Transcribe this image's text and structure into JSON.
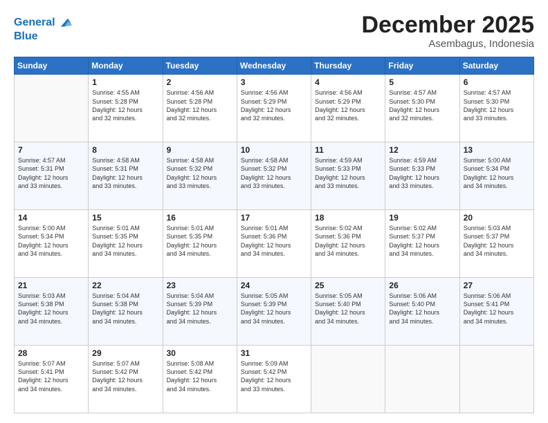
{
  "header": {
    "logo_line1": "General",
    "logo_line2": "Blue",
    "month": "December 2025",
    "location": "Asembagus, Indonesia"
  },
  "weekdays": [
    "Sunday",
    "Monday",
    "Tuesday",
    "Wednesday",
    "Thursday",
    "Friday",
    "Saturday"
  ],
  "weeks": [
    [
      {
        "day": "",
        "info": ""
      },
      {
        "day": "1",
        "info": "Sunrise: 4:55 AM\nSunset: 5:28 PM\nDaylight: 12 hours\nand 32 minutes."
      },
      {
        "day": "2",
        "info": "Sunrise: 4:56 AM\nSunset: 5:28 PM\nDaylight: 12 hours\nand 32 minutes."
      },
      {
        "day": "3",
        "info": "Sunrise: 4:56 AM\nSunset: 5:29 PM\nDaylight: 12 hours\nand 32 minutes."
      },
      {
        "day": "4",
        "info": "Sunrise: 4:56 AM\nSunset: 5:29 PM\nDaylight: 12 hours\nand 32 minutes."
      },
      {
        "day": "5",
        "info": "Sunrise: 4:57 AM\nSunset: 5:30 PM\nDaylight: 12 hours\nand 32 minutes."
      },
      {
        "day": "6",
        "info": "Sunrise: 4:57 AM\nSunset: 5:30 PM\nDaylight: 12 hours\nand 33 minutes."
      }
    ],
    [
      {
        "day": "7",
        "info": "Sunrise: 4:57 AM\nSunset: 5:31 PM\nDaylight: 12 hours\nand 33 minutes."
      },
      {
        "day": "8",
        "info": "Sunrise: 4:58 AM\nSunset: 5:31 PM\nDaylight: 12 hours\nand 33 minutes."
      },
      {
        "day": "9",
        "info": "Sunrise: 4:58 AM\nSunset: 5:32 PM\nDaylight: 12 hours\nand 33 minutes."
      },
      {
        "day": "10",
        "info": "Sunrise: 4:58 AM\nSunset: 5:32 PM\nDaylight: 12 hours\nand 33 minutes."
      },
      {
        "day": "11",
        "info": "Sunrise: 4:59 AM\nSunset: 5:33 PM\nDaylight: 12 hours\nand 33 minutes."
      },
      {
        "day": "12",
        "info": "Sunrise: 4:59 AM\nSunset: 5:33 PM\nDaylight: 12 hours\nand 33 minutes."
      },
      {
        "day": "13",
        "info": "Sunrise: 5:00 AM\nSunset: 5:34 PM\nDaylight: 12 hours\nand 34 minutes."
      }
    ],
    [
      {
        "day": "14",
        "info": "Sunrise: 5:00 AM\nSunset: 5:34 PM\nDaylight: 12 hours\nand 34 minutes."
      },
      {
        "day": "15",
        "info": "Sunrise: 5:01 AM\nSunset: 5:35 PM\nDaylight: 12 hours\nand 34 minutes."
      },
      {
        "day": "16",
        "info": "Sunrise: 5:01 AM\nSunset: 5:35 PM\nDaylight: 12 hours\nand 34 minutes."
      },
      {
        "day": "17",
        "info": "Sunrise: 5:01 AM\nSunset: 5:36 PM\nDaylight: 12 hours\nand 34 minutes."
      },
      {
        "day": "18",
        "info": "Sunrise: 5:02 AM\nSunset: 5:36 PM\nDaylight: 12 hours\nand 34 minutes."
      },
      {
        "day": "19",
        "info": "Sunrise: 5:02 AM\nSunset: 5:37 PM\nDaylight: 12 hours\nand 34 minutes."
      },
      {
        "day": "20",
        "info": "Sunrise: 5:03 AM\nSunset: 5:37 PM\nDaylight: 12 hours\nand 34 minutes."
      }
    ],
    [
      {
        "day": "21",
        "info": "Sunrise: 5:03 AM\nSunset: 5:38 PM\nDaylight: 12 hours\nand 34 minutes."
      },
      {
        "day": "22",
        "info": "Sunrise: 5:04 AM\nSunset: 5:38 PM\nDaylight: 12 hours\nand 34 minutes."
      },
      {
        "day": "23",
        "info": "Sunrise: 5:04 AM\nSunset: 5:39 PM\nDaylight: 12 hours\nand 34 minutes."
      },
      {
        "day": "24",
        "info": "Sunrise: 5:05 AM\nSunset: 5:39 PM\nDaylight: 12 hours\nand 34 minutes."
      },
      {
        "day": "25",
        "info": "Sunrise: 5:05 AM\nSunset: 5:40 PM\nDaylight: 12 hours\nand 34 minutes."
      },
      {
        "day": "26",
        "info": "Sunrise: 5:06 AM\nSunset: 5:40 PM\nDaylight: 12 hours\nand 34 minutes."
      },
      {
        "day": "27",
        "info": "Sunrise: 5:06 AM\nSunset: 5:41 PM\nDaylight: 12 hours\nand 34 minutes."
      }
    ],
    [
      {
        "day": "28",
        "info": "Sunrise: 5:07 AM\nSunset: 5:41 PM\nDaylight: 12 hours\nand 34 minutes."
      },
      {
        "day": "29",
        "info": "Sunrise: 5:07 AM\nSunset: 5:42 PM\nDaylight: 12 hours\nand 34 minutes."
      },
      {
        "day": "30",
        "info": "Sunrise: 5:08 AM\nSunset: 5:42 PM\nDaylight: 12 hours\nand 34 minutes."
      },
      {
        "day": "31",
        "info": "Sunrise: 5:09 AM\nSunset: 5:42 PM\nDaylight: 12 hours\nand 33 minutes."
      },
      {
        "day": "",
        "info": ""
      },
      {
        "day": "",
        "info": ""
      },
      {
        "day": "",
        "info": ""
      }
    ]
  ]
}
